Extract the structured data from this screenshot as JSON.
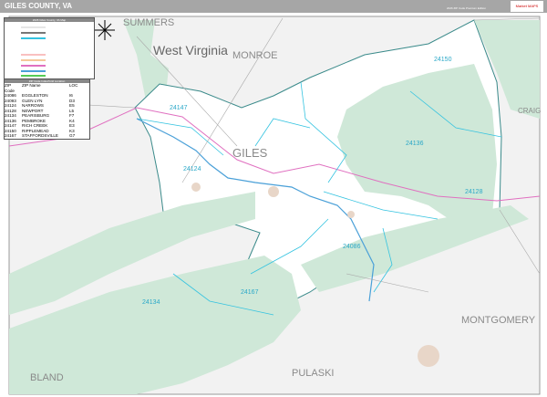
{
  "header": {
    "title": "GILES COUNTY, VA",
    "edition": "2026 ZIP Code Premium Edition",
    "logo_text": "Market MAPS"
  },
  "legend": {
    "title": "2026 Giles County, VA Map",
    "zip_table_title": "ZIP Code Index/Grid Location"
  },
  "zip_table": {
    "headers": [
      "ZIP Code",
      "ZIP Name",
      "LOC"
    ],
    "rows": [
      [
        "24086",
        "EGGLESTON",
        "I6"
      ],
      [
        "24093",
        "GLEN LYN",
        "D3"
      ],
      [
        "24124",
        "NARROWS",
        "E5"
      ],
      [
        "24128",
        "NEWPORT",
        "L5"
      ],
      [
        "24134",
        "PEARISBURG",
        "F7"
      ],
      [
        "24136",
        "PEMBROKE",
        "K4"
      ],
      [
        "24147",
        "RICH CREEK",
        "E3"
      ],
      [
        "24150",
        "RIPPLEMEAD",
        "K3"
      ],
      [
        "24167",
        "STAFFORDSVILLE",
        "G7"
      ]
    ]
  },
  "map_labels": {
    "state": "West Virginia",
    "counties": {
      "summers": "SUMMERS",
      "monroe": "MONROE",
      "craig": "CRAIG",
      "giles": "GILES",
      "montgomery": "MONTGOMERY",
      "bland": "BLAND",
      "pulaski": "PULASKI"
    }
  },
  "zip_labels": {
    "z24150": "24150",
    "z24147": "24147",
    "z24136": "24136",
    "z24124": "24124",
    "z24128": "24128",
    "z24086": "24086",
    "z24167": "24167",
    "z24134": "24134"
  },
  "colors": {
    "header": "#a6a6a6",
    "forest": "#cfe8d8",
    "county_fill": "#ffffff",
    "background": "#f2f2f2",
    "zip_lines": "#34c3e0",
    "state_line": "#e070c0",
    "county_line": "#3a8a8a"
  }
}
